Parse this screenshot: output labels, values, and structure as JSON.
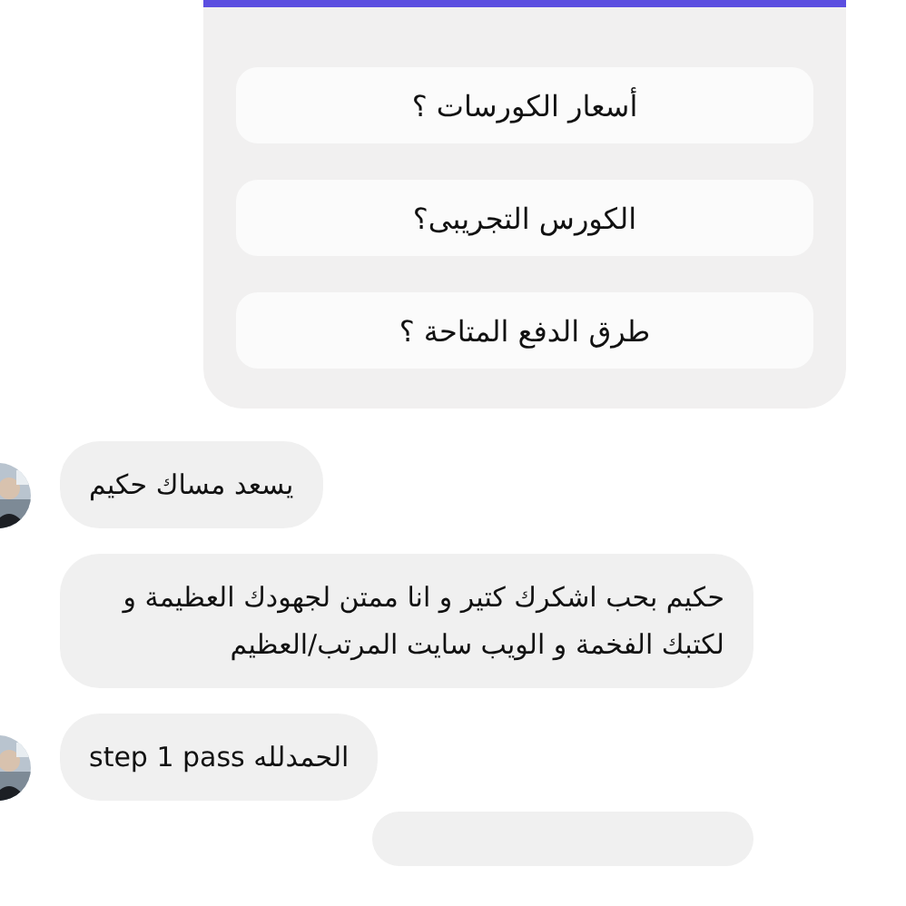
{
  "quick_replies": [
    "أسعار الكورسات ؟",
    "الكورس التجريبى؟",
    "طرق الدفع المتاحة ؟"
  ],
  "messages": [
    {
      "text": "يسعد مساك حكيم",
      "avatar": true
    },
    {
      "text": "حكيم بحب اشكرك كتير و انا ممتن لجهودك العظيمة و لكتبك الفخمة و الويب سايت المرتب/العظيم",
      "avatar": false
    },
    {
      "text": "الحمدلله step 1 pass",
      "avatar": true
    }
  ]
}
